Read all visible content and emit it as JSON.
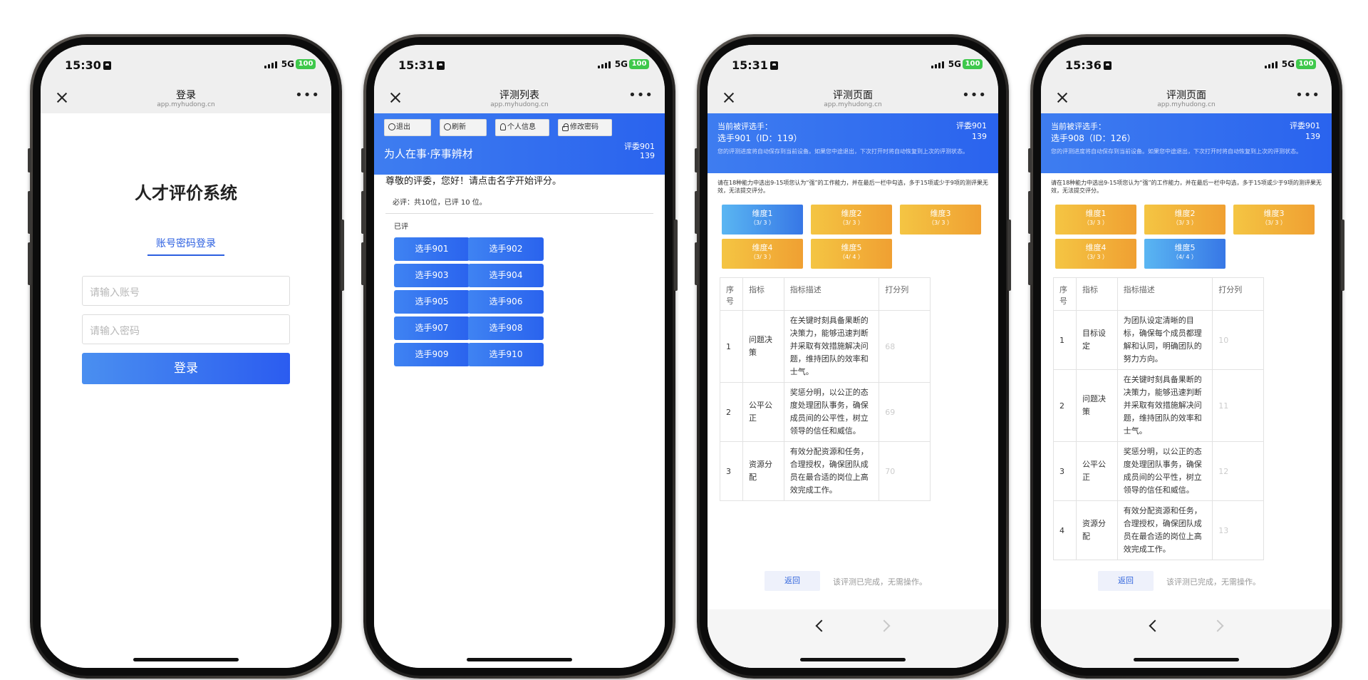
{
  "status_bar": {
    "network": "5G",
    "battery": "100"
  },
  "nav": {
    "url": "app.myhudong.cn"
  },
  "phone1": {
    "time": "15:30",
    "nav_title": "登录",
    "system_title": "人才评价系统",
    "login_tab": "账号密码登录",
    "account_placeholder": "请输入账号",
    "password_placeholder": "请输入密码",
    "login_button": "登录"
  },
  "phone2": {
    "time": "15:31",
    "nav_title": "评测列表",
    "toolbar": {
      "logout": "退出",
      "refresh": "刷新",
      "profile": "个人信息",
      "change_password": "修改密码"
    },
    "header_title": "为人在事·序事辨材",
    "judge_name": "评委901",
    "judge_id": "139",
    "greeting": "尊敬的评委，您好！请点击名字开始评分。",
    "required_count": "必评：共10位，已评 10 位。",
    "done_label": "已评",
    "candidates": [
      "选手901",
      "选手902",
      "选手903",
      "选手904",
      "选手905",
      "选手906",
      "选手907",
      "选手908",
      "选手909",
      "选手910"
    ]
  },
  "phone3": {
    "time": "15:31",
    "nav_title": "评测页面",
    "current_label": "当前被评选手：",
    "current_candidate": "选手901（ID：119）",
    "judge_name": "评委901",
    "judge_id": "139",
    "autosave_note": "您的评测进度将自动保存到当前设备。如果您中途退出，下次打开时将自动恢复到上次的评测状态。",
    "instruction": "请在18种能力中选出9-15项您认为“强”的工作能力，并在最后一栏中勾选，多于15项或少于9项的测评果无效，无法提交评分。",
    "dimensions": [
      {
        "name": "维度1",
        "progress": "（3/ 3 ）"
      },
      {
        "name": "维度2",
        "progress": "（3/ 3 ）"
      },
      {
        "name": "维度3",
        "progress": "（3/ 3 ）"
      },
      {
        "name": "维度4",
        "progress": "（3/ 3 ）"
      },
      {
        "name": "维度5",
        "progress": "（4/ 4 ）"
      }
    ],
    "table_headers": [
      "序号",
      "指标",
      "指标描述",
      "打分列"
    ],
    "rows": [
      {
        "no": "1",
        "name": "问题决策",
        "desc": "在关键时刻具备果断的决策力，能够迅速判断并采取有效措施解决问题，维持团队的效率和士气。",
        "score": "68"
      },
      {
        "no": "2",
        "name": "公平公正",
        "desc": "奖惩分明，以公正的态度处理团队事务，确保成员间的公平性，树立领导的信任和威信。",
        "score": "69"
      },
      {
        "no": "3",
        "name": "资源分配",
        "desc": "有效分配资源和任务，合理授权，确保团队成员在最合适的岗位上高效完成工作。",
        "score": "70"
      }
    ],
    "back_button": "返回",
    "finish_text": "该评测已完成，无需操作。"
  },
  "phone4": {
    "time": "15:36",
    "nav_title": "评测页面",
    "current_label": "当前被评选手：",
    "current_candidate": "选手908（ID：126）",
    "judge_name": "评委901",
    "judge_id": "139",
    "autosave_note": "您的评测进度将自动保存到当前设备。如果您中途退出，下次打开时将自动恢复到上次的评测状态。",
    "instruction": "请在18种能力中选出9-15项您认为“强”的工作能力，并在最后一栏中勾选，多于15项或少于9项的测评果无效，无法提交评分。",
    "dimensions": [
      {
        "name": "维度1",
        "progress": "（3/ 3 ）"
      },
      {
        "name": "维度2",
        "progress": "（3/ 3 ）"
      },
      {
        "name": "维度3",
        "progress": "（3/ 3 ）"
      },
      {
        "name": "维度4",
        "progress": "（3/ 3 ）"
      },
      {
        "name": "维度5",
        "progress": "（4/ 4 ）"
      }
    ],
    "table_headers": [
      "序号",
      "指标",
      "指标描述",
      "打分列"
    ],
    "rows": [
      {
        "no": "1",
        "name": "目标设定",
        "desc": "为团队设定清晰的目标，确保每个成员都理解和认同，明确团队的努力方向。",
        "score": "10"
      },
      {
        "no": "2",
        "name": "问题决策",
        "desc": "在关键时刻具备果断的决策力，能够迅速判断并采取有效措施解决问题，维持团队的效率和士气。",
        "score": "11"
      },
      {
        "no": "3",
        "name": "公平公正",
        "desc": "奖惩分明，以公正的态度处理团队事务，确保成员间的公平性，树立领导的信任和威信。",
        "score": "12"
      },
      {
        "no": "4",
        "name": "资源分配",
        "desc": "有效分配资源和任务，合理授权，确保团队成员在最合适的岗位上高效完成工作。",
        "score": "13"
      }
    ],
    "back_button": "返回",
    "finish_text": "该评测已完成，无需操作。"
  }
}
